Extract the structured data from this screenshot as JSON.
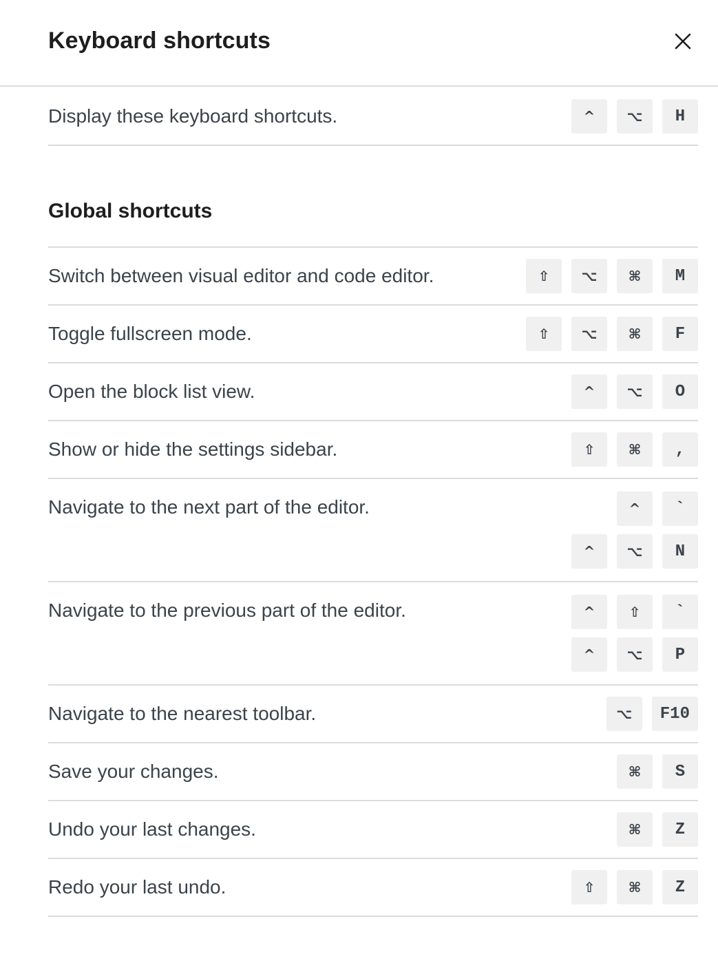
{
  "modal": {
    "title": "Keyboard shortcuts",
    "close_icon": "close-icon"
  },
  "main_shortcuts": [
    {
      "description": "Display these keyboard shortcuts.",
      "combos": [
        [
          "^",
          "⌥",
          "H"
        ]
      ]
    }
  ],
  "global_section": {
    "title": "Global shortcuts",
    "items": [
      {
        "description": "Switch between visual editor and code editor.",
        "combos": [
          [
            "⇧",
            "⌥",
            "⌘",
            "M"
          ]
        ]
      },
      {
        "description": "Toggle fullscreen mode.",
        "combos": [
          [
            "⇧",
            "⌥",
            "⌘",
            "F"
          ]
        ]
      },
      {
        "description": "Open the block list view.",
        "combos": [
          [
            "^",
            "⌥",
            "O"
          ]
        ]
      },
      {
        "description": "Show or hide the settings sidebar.",
        "combos": [
          [
            "⇧",
            "⌘",
            ","
          ]
        ]
      },
      {
        "description": "Navigate to the next part of the editor.",
        "combos": [
          [
            "^",
            "`"
          ],
          [
            "^",
            "⌥",
            "N"
          ]
        ]
      },
      {
        "description": "Navigate to the previous part of the editor.",
        "combos": [
          [
            "^",
            "⇧",
            "`"
          ],
          [
            "^",
            "⌥",
            "P"
          ]
        ]
      },
      {
        "description": "Navigate to the nearest toolbar.",
        "combos": [
          [
            "⌥",
            "F10"
          ]
        ]
      },
      {
        "description": "Save your changes.",
        "combos": [
          [
            "⌘",
            "S"
          ]
        ]
      },
      {
        "description": "Undo your last changes.",
        "combos": [
          [
            "⌘",
            "Z"
          ]
        ]
      },
      {
        "description": "Redo your last undo.",
        "combos": [
          [
            "⇧",
            "⌘",
            "Z"
          ]
        ]
      }
    ]
  }
}
